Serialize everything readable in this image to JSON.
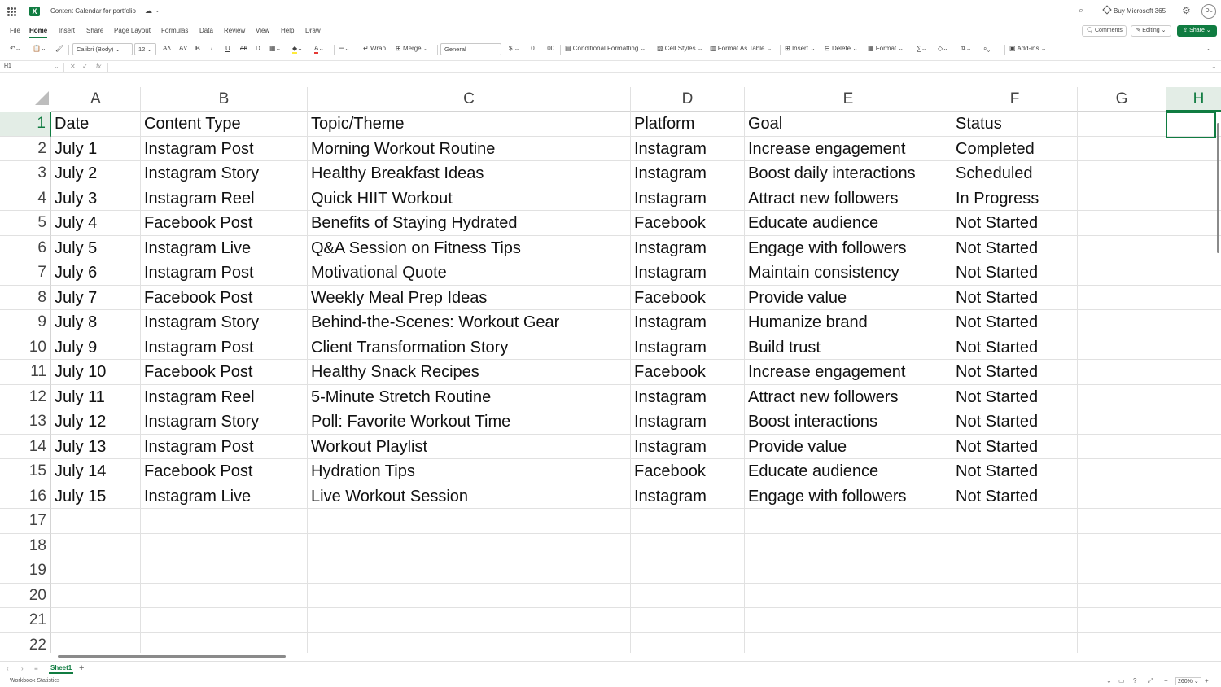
{
  "app": {
    "title": "Content Calendar for portfolio",
    "buy_label": "Buy Microsoft 365",
    "avatar_initials": "DL",
    "accent_color": "#107c41"
  },
  "ribbon": {
    "tabs": [
      "File",
      "Home",
      "Insert",
      "Share",
      "Page Layout",
      "Formulas",
      "Data",
      "Review",
      "View",
      "Help",
      "Draw"
    ],
    "active_tab": "Home",
    "comments_label": "Comments",
    "editing_label": "Editing",
    "share_label": "Share",
    "font_name": "Calibri (Body)",
    "font_size": "12",
    "wrap_label": "Wrap",
    "merge_label": "Merge",
    "number_format": "General",
    "currency_symbol": "$",
    "conditional_formatting": "Conditional Formatting",
    "cell_styles": "Cell Styles",
    "format_as_table": "Format As Table",
    "insert_label": "Insert",
    "delete_label": "Delete",
    "format_label": "Format",
    "addins_label": "Add-ins"
  },
  "formula_bar": {
    "name_box": "H1",
    "fx": "fx",
    "content": ""
  },
  "sheet": {
    "columns": [
      "A",
      "B",
      "C",
      "D",
      "E",
      "F",
      "G",
      "H"
    ],
    "selected_column": "H",
    "selected_row": 1,
    "row_numbers": [
      1,
      2,
      3,
      4,
      5,
      6,
      7,
      8,
      9,
      10,
      11,
      12,
      13,
      14,
      15,
      16,
      17,
      18,
      19,
      20,
      21,
      22
    ],
    "rows": [
      [
        "Date",
        "Content Type",
        "Topic/Theme",
        "Platform",
        "Goal",
        "Status"
      ],
      [
        "July 1",
        "Instagram Post",
        "Morning Workout Routine",
        "Instagram",
        "Increase engagement",
        "Completed"
      ],
      [
        "July 2",
        "Instagram Story",
        "Healthy Breakfast Ideas",
        "Instagram",
        "Boost daily interactions",
        "Scheduled"
      ],
      [
        "July 3",
        "Instagram Reel",
        "Quick HIIT Workout",
        "Instagram",
        "Attract new followers",
        "In Progress"
      ],
      [
        "July 4",
        "Facebook Post",
        "Benefits of Staying Hydrated",
        "Facebook",
        "Educate audience",
        "Not Started"
      ],
      [
        "July 5",
        "Instagram Live",
        "Q&A Session on Fitness Tips",
        "Instagram",
        "Engage with followers",
        "Not Started"
      ],
      [
        "July 6",
        "Instagram Post",
        "Motivational Quote",
        "Instagram",
        "Maintain consistency",
        "Not Started"
      ],
      [
        "July 7",
        "Facebook Post",
        "Weekly Meal Prep Ideas",
        "Facebook",
        "Provide value",
        "Not Started"
      ],
      [
        "July 8",
        "Instagram Story",
        "Behind-the-Scenes: Workout Gear",
        "Instagram",
        "Humanize brand",
        "Not Started"
      ],
      [
        "July 9",
        "Instagram Post",
        "Client Transformation Story",
        "Instagram",
        "Build trust",
        "Not Started"
      ],
      [
        "July 10",
        "Facebook Post",
        "Healthy Snack Recipes",
        "Facebook",
        "Increase engagement",
        "Not Started"
      ],
      [
        "July 11",
        "Instagram Reel",
        "5-Minute Stretch Routine",
        "Instagram",
        "Attract new followers",
        "Not Started"
      ],
      [
        "July 12",
        "Instagram Story",
        "Poll: Favorite Workout Time",
        "Instagram",
        "Boost interactions",
        "Not Started"
      ],
      [
        "July 13",
        "Instagram Post",
        "Workout Playlist",
        "Instagram",
        "Provide value",
        "Not Started"
      ],
      [
        "July 14",
        "Facebook Post",
        "Hydration Tips",
        "Facebook",
        "Educate audience",
        "Not Started"
      ],
      [
        "July 15",
        "Instagram Live",
        "Live Workout Session",
        "Instagram",
        "Engage with followers",
        "Not Started"
      ]
    ]
  },
  "footer": {
    "sheet_tab": "Sheet1",
    "status_left": "Workbook Statistics",
    "zoom": "260%"
  }
}
